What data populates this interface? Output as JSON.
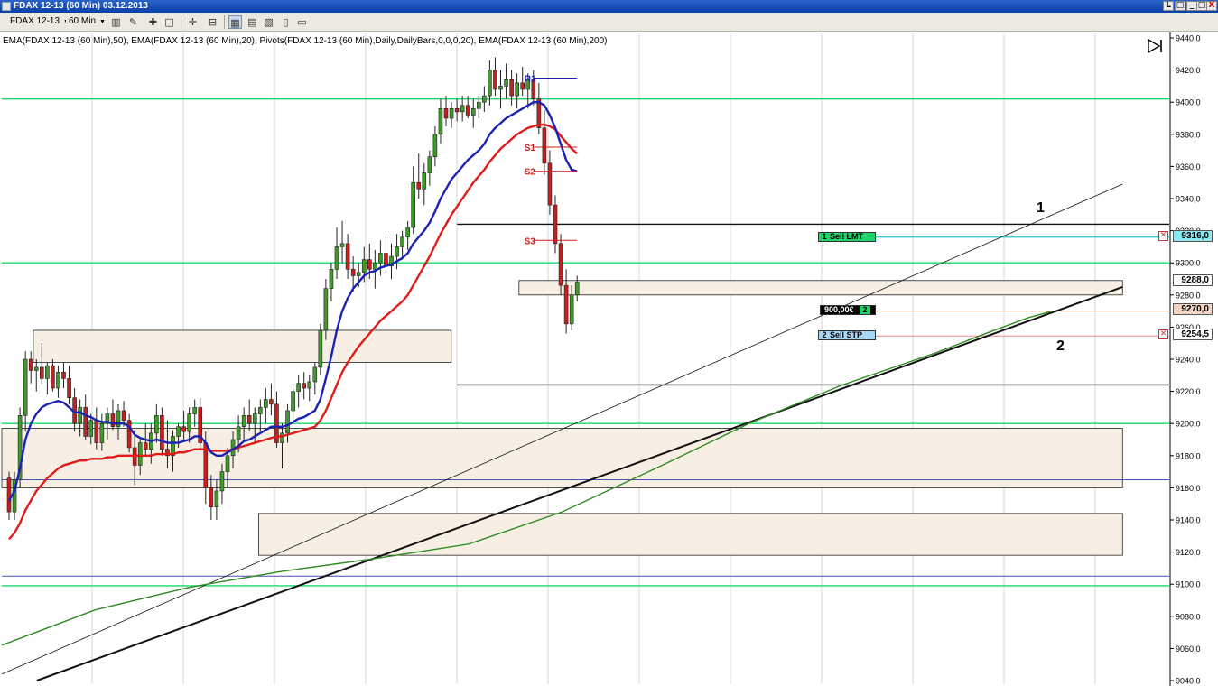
{
  "window": {
    "title": "FDAX 12-13 (60 Min)  03.12.2013",
    "buttons": [
      "_",
      "□",
      "X"
    ],
    "extra_buttons": [
      "L",
      "□",
      "□"
    ]
  },
  "toolbar": {
    "instrument": "FDAX 12-13",
    "interval": "60 Min",
    "icons": [
      "bar-style-icon",
      "draw-pencil-icon",
      "add-indicator-icon",
      "zoom-icon",
      "crosshair-icon",
      "zoom-out-icon",
      "chart-trader-icon",
      "properties-icon",
      "data-box-icon",
      "template-icon",
      "print-icon"
    ]
  },
  "indicators_line": "EMA(FDAX 12-13 (60 Min),50), EMA(FDAX 12-13 (60 Min),20), Pivots(FDAX 12-13 (60 Min),Daily,DailyBars,0,0,0,20), EMA(FDAX 12-13 (60 Min),200)",
  "orders": {
    "sell_limit": {
      "qty": "1",
      "label": "Sell LMT",
      "price": "9316,0"
    },
    "sell_stop": {
      "qty": "2",
      "label": "Sell STP",
      "price": "9254,5"
    },
    "position": {
      "pnl": "900,00€",
      "qty": "2",
      "price": "9270,0"
    },
    "last_price": "9288,0"
  },
  "annotations": {
    "label_1": "1",
    "label_2": "2"
  },
  "colors": {
    "bull": "#3f9a2a",
    "bear": "#c81e1e",
    "ema20": "#1a22b4",
    "ema50": "#e01b1b",
    "ema200": "#2e8b22",
    "pivot_green": "#15d86b",
    "pivot_red": "#c81e1e",
    "zone_fill": "#f7efe4",
    "sell_lmt": "#22c7d1",
    "position": "#d08b5a"
  },
  "chart_data": {
    "type": "candlestick",
    "ylim": [
      9040,
      9440
    ],
    "y_ticks": [
      "9440,0",
      "9420,0",
      "9400,0",
      "9380,0",
      "9360,0",
      "9340,0",
      "9320,0",
      "9300,0",
      "9280,0",
      "9260,0",
      "9240,0",
      "9220,0",
      "9200,0",
      "9180,0",
      "9160,0",
      "9140,0",
      "9120,0",
      "9100,0",
      "9080,0",
      "9060,0",
      "9040,0"
    ],
    "pivot_labels": [
      {
        "name": "R1",
        "price": 9415
      },
      {
        "name": "S1",
        "price": 9372
      },
      {
        "name": "S2",
        "price": 9357
      },
      {
        "name": "S3",
        "price": 9314
      }
    ],
    "horizontal_levels": {
      "green": [
        9402,
        9300,
        9200,
        9099
      ],
      "blue": [
        9165,
        9105
      ],
      "black": [
        9324,
        9224
      ],
      "cyan": 9316,
      "orange": 9270,
      "red_stop": 9254.5
    },
    "zones": [
      {
        "x_from": 0.027,
        "x_to": 0.385,
        "y_from": 9238,
        "y_to": 9258
      },
      {
        "x_from": 0.443,
        "x_to": 0.96,
        "y_from": 9280,
        "y_to": 9289
      },
      {
        "x_from": 0.0,
        "x_to": 0.96,
        "y_from": 9160,
        "y_to": 9197
      },
      {
        "x_from": 0.22,
        "x_to": 0.96,
        "y_from": 9118,
        "y_to": 9144
      }
    ],
    "candles": [
      [
        9166,
        9170,
        9140,
        9145
      ],
      [
        9145,
        9170,
        9140,
        9165
      ],
      [
        9165,
        9210,
        9160,
        9205
      ],
      [
        9205,
        9245,
        9195,
        9240
      ],
      [
        9240,
        9245,
        9225,
        9233
      ],
      [
        9233,
        9240,
        9220,
        9235
      ],
      [
        9235,
        9250,
        9225,
        9228
      ],
      [
        9228,
        9238,
        9218,
        9236
      ],
      [
        9236,
        9240,
        9220,
        9222
      ],
      [
        9222,
        9236,
        9216,
        9232
      ],
      [
        9232,
        9238,
        9222,
        9228
      ],
      [
        9228,
        9236,
        9212,
        9216
      ],
      [
        9216,
        9222,
        9195,
        9200
      ],
      [
        9200,
        9215,
        9192,
        9210
      ],
      [
        9210,
        9218,
        9190,
        9192
      ],
      [
        9192,
        9206,
        9187,
        9202
      ],
      [
        9202,
        9210,
        9184,
        9188
      ],
      [
        9188,
        9206,
        9183,
        9200
      ],
      [
        9200,
        9210,
        9190,
        9206
      ],
      [
        9206,
        9215,
        9196,
        9198
      ],
      [
        9198,
        9212,
        9190,
        9208
      ],
      [
        9208,
        9214,
        9198,
        9202
      ],
      [
        9202,
        9206,
        9182,
        9185
      ],
      [
        9185,
        9196,
        9162,
        9174
      ],
      [
        9174,
        9190,
        9168,
        9188
      ],
      [
        9188,
        9200,
        9180,
        9184
      ],
      [
        9184,
        9200,
        9175,
        9194
      ],
      [
        9194,
        9212,
        9188,
        9205
      ],
      [
        9205,
        9210,
        9180,
        9184
      ],
      [
        9184,
        9202,
        9172,
        9180
      ],
      [
        9180,
        9196,
        9170,
        9192
      ],
      [
        9192,
        9200,
        9185,
        9198
      ],
      [
        9198,
        9208,
        9190,
        9195
      ],
      [
        9195,
        9210,
        9188,
        9206
      ],
      [
        9206,
        9215,
        9198,
        9210
      ],
      [
        9210,
        9216,
        9184,
        9188
      ],
      [
        9188,
        9195,
        9150,
        9160
      ],
      [
        9160,
        9168,
        9140,
        9148
      ],
      [
        9148,
        9165,
        9140,
        9158
      ],
      [
        9158,
        9175,
        9150,
        9170
      ],
      [
        9170,
        9185,
        9160,
        9180
      ],
      [
        9180,
        9195,
        9172,
        9190
      ],
      [
        9190,
        9205,
        9182,
        9198
      ],
      [
        9198,
        9210,
        9190,
        9205
      ],
      [
        9205,
        9215,
        9195,
        9200
      ],
      [
        9200,
        9210,
        9188,
        9206
      ],
      [
        9206,
        9215,
        9195,
        9210
      ],
      [
        9210,
        9222,
        9200,
        9215
      ],
      [
        9215,
        9225,
        9205,
        9212
      ],
      [
        9212,
        9220,
        9185,
        9188
      ],
      [
        9188,
        9200,
        9172,
        9194
      ],
      [
        9194,
        9212,
        9188,
        9208
      ],
      [
        9208,
        9225,
        9200,
        9220
      ],
      [
        9220,
        9230,
        9210,
        9225
      ],
      [
        9225,
        9232,
        9215,
        9222
      ],
      [
        9222,
        9230,
        9214,
        9226
      ],
      [
        9226,
        9238,
        9218,
        9235
      ],
      [
        9235,
        9262,
        9230,
        9258
      ],
      [
        9258,
        9290,
        9252,
        9284
      ],
      [
        9284,
        9300,
        9276,
        9296
      ],
      [
        9296,
        9322,
        9290,
        9310
      ],
      [
        9310,
        9326,
        9300,
        9312
      ],
      [
        9312,
        9318,
        9290,
        9296
      ],
      [
        9296,
        9304,
        9282,
        9292
      ],
      [
        9292,
        9300,
        9285,
        9294
      ],
      [
        9294,
        9310,
        9288,
        9302
      ],
      [
        9302,
        9312,
        9290,
        9296
      ],
      [
        9296,
        9308,
        9284,
        9300
      ],
      [
        9300,
        9314,
        9292,
        9306
      ],
      [
        9306,
        9316,
        9294,
        9298
      ],
      [
        9298,
        9312,
        9290,
        9304
      ],
      [
        9304,
        9318,
        9296,
        9310
      ],
      [
        9310,
        9320,
        9302,
        9316
      ],
      [
        9316,
        9326,
        9308,
        9322
      ],
      [
        9322,
        9360,
        9318,
        9350
      ],
      [
        9350,
        9368,
        9340,
        9346
      ],
      [
        9346,
        9362,
        9336,
        9356
      ],
      [
        9356,
        9370,
        9348,
        9366
      ],
      [
        9366,
        9385,
        9360,
        9380
      ],
      [
        9380,
        9402,
        9374,
        9396
      ],
      [
        9396,
        9404,
        9385,
        9390
      ],
      [
        9390,
        9400,
        9384,
        9396
      ],
      [
        9396,
        9402,
        9388,
        9394
      ],
      [
        9394,
        9404,
        9388,
        9398
      ],
      [
        9398,
        9404,
        9390,
        9392
      ],
      [
        9392,
        9402,
        9384,
        9396
      ],
      [
        9396,
        9404,
        9390,
        9400
      ],
      [
        9400,
        9410,
        9394,
        9404
      ],
      [
        9404,
        9426,
        9398,
        9420
      ],
      [
        9420,
        9428,
        9404,
        9408
      ],
      [
        9408,
        9420,
        9396,
        9410
      ],
      [
        9410,
        9424,
        9402,
        9414
      ],
      [
        9414,
        9420,
        9398,
        9404
      ],
      [
        9404,
        9418,
        9396,
        9412
      ],
      [
        9412,
        9422,
        9404,
        9408
      ],
      [
        9408,
        9418,
        9396,
        9414
      ],
      [
        9414,
        9420,
        9398,
        9402
      ],
      [
        9402,
        9412,
        9380,
        9384
      ],
      [
        9384,
        9395,
        9355,
        9362
      ],
      [
        9362,
        9370,
        9330,
        9336
      ],
      [
        9336,
        9342,
        9306,
        9312
      ],
      [
        9312,
        9318,
        9280,
        9286
      ],
      [
        9286,
        9296,
        9256,
        9262
      ],
      [
        9262,
        9286,
        9258,
        9280
      ],
      [
        9280,
        9292,
        9276,
        9288
      ]
    ],
    "ema20": [
      9152,
      9158,
      9172,
      9190,
      9200,
      9206,
      9210,
      9212,
      9213,
      9214,
      9213,
      9210,
      9207,
      9207,
      9205,
      9204,
      9202,
      9201,
      9201,
      9200,
      9200,
      9200,
      9198,
      9193,
      9191,
      9190,
      9189,
      9190,
      9189,
      9188,
      9188,
      9188,
      9189,
      9190,
      9192,
      9192,
      9188,
      9182,
      9180,
      9180,
      9182,
      9184,
      9186,
      9189,
      9190,
      9192,
      9194,
      9196,
      9198,
      9198,
      9198,
      9199,
      9201,
      9203,
      9204,
      9206,
      9208,
      9215,
      9228,
      9242,
      9258,
      9270,
      9278,
      9284,
      9288,
      9292,
      9294,
      9295,
      9297,
      9298,
      9299,
      9301,
      9303,
      9306,
      9312,
      9316,
      9320,
      9325,
      9332,
      9340,
      9346,
      9352,
      9356,
      9360,
      9364,
      9367,
      9370,
      9374,
      9380,
      9384,
      9387,
      9390,
      9392,
      9394,
      9396,
      9398,
      9400,
      9400,
      9398,
      9392,
      9384,
      9374,
      9364,
      9358,
      9357
    ],
    "ema50": [
      9128,
      9132,
      9138,
      9146,
      9152,
      9158,
      9162,
      9166,
      9169,
      9172,
      9174,
      9175,
      9176,
      9177,
      9177,
      9178,
      9178,
      9178,
      9179,
      9179,
      9180,
      9180,
      9180,
      9180,
      9180,
      9180,
      9180,
      9181,
      9181,
      9181,
      9181,
      9182,
      9182,
      9183,
      9184,
      9184,
      9184,
      9183,
      9183,
      9183,
      9183,
      9184,
      9185,
      9186,
      9187,
      9188,
      9189,
      9190,
      9191,
      9192,
      9192,
      9193,
      9194,
      9195,
      9196,
      9197,
      9198,
      9202,
      9208,
      9216,
      9224,
      9232,
      9238,
      9243,
      9248,
      9252,
      9256,
      9260,
      9264,
      9267,
      9270,
      9273,
      9276,
      9280,
      9286,
      9292,
      9298,
      9304,
      9311,
      9318,
      9324,
      9330,
      9335,
      9340,
      9345,
      9350,
      9354,
      9358,
      9363,
      9367,
      9371,
      9374,
      9377,
      9380,
      9382,
      9384,
      9385,
      9386,
      9386,
      9385,
      9383,
      9379,
      9375,
      9371,
      9368
    ],
    "ema200_path": [
      [
        0.0,
        9062
      ],
      [
        0.08,
        9084
      ],
      [
        0.16,
        9098
      ],
      [
        0.24,
        9108
      ],
      [
        0.32,
        9116
      ],
      [
        0.4,
        9125
      ],
      [
        0.48,
        9145
      ],
      [
        0.56,
        9172
      ],
      [
        0.64,
        9200
      ],
      [
        0.72,
        9224
      ],
      [
        0.8,
        9244
      ],
      [
        0.85,
        9258
      ],
      [
        0.88,
        9266
      ],
      [
        0.9,
        9270
      ]
    ],
    "trendline_thick": [
      [
        0.03,
        9040
      ],
      [
        0.96,
        9285
      ]
    ],
    "trendline_thin": [
      [
        0.0,
        9044
      ],
      [
        0.96,
        9349
      ]
    ]
  }
}
